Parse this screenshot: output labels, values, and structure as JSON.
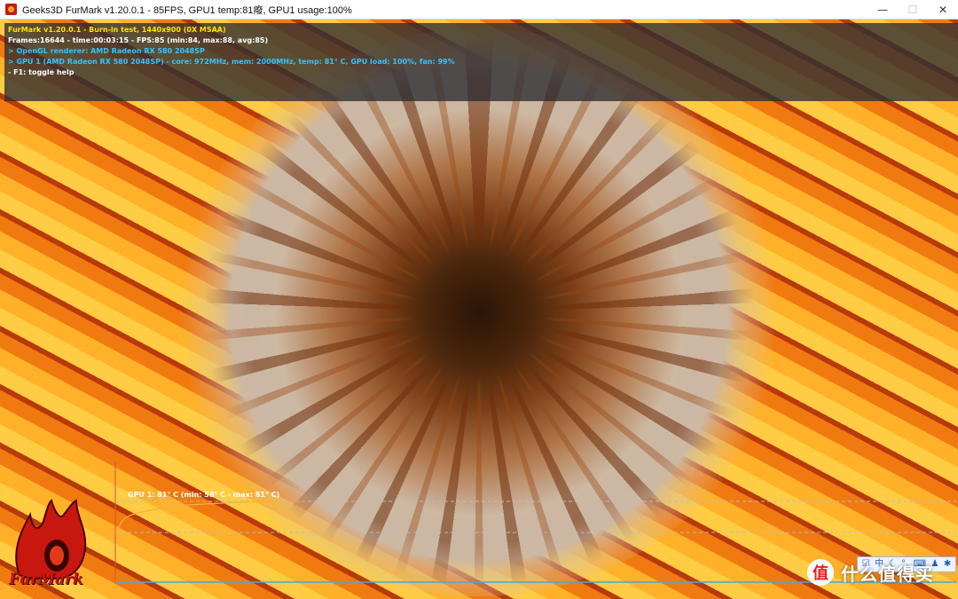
{
  "window": {
    "title": "Geeks3D FurMark v1.20.0.1 - 85FPS, GPU1 temp:81癈, GPU1 usage:100%",
    "controls": {
      "minimize": "—",
      "maximize": "☐",
      "close": "✕"
    }
  },
  "overlay": {
    "line1": "FurMark v1.20.0.1 - Burn-in test, 1440x900 (0X MSAA)",
    "line2": "Frames:16644 - time:00:03:15 - FPS:85 (min:84, max:88, avg:85)",
    "line3": "> OpenGL renderer: AMD Radeon RX 580 2048SP",
    "line4": "> GPU 1 (AMD Radeon RX 580 2048SP) - core: 972MHz, mem: 2000MHz, temp: 81° C, GPU load: 100%, fan: 99%",
    "line5": "- F1: toggle help"
  },
  "temperature_graph": {
    "label": "GPU 1: 81° C (min: 58° C - max: 81° C)",
    "current_c": 81,
    "min_c": 58,
    "max_c": 81,
    "line_color": "#f3b23c",
    "axis_color": "#41a9e6"
  },
  "logo": {
    "text": "FurMark"
  },
  "tray": {
    "icons": [
      "checkbox-icon",
      "chinese-input-icon",
      "moon-icon",
      "punctuation-icon",
      "keyboard-icon",
      "user-icon",
      "settings-icon"
    ],
    "glyphs": [
      "☑",
      "中",
      "☾",
      "°,",
      "⌨",
      "♟",
      "✱"
    ]
  },
  "watermark": {
    "badge": "值",
    "text": "什么值得买"
  }
}
